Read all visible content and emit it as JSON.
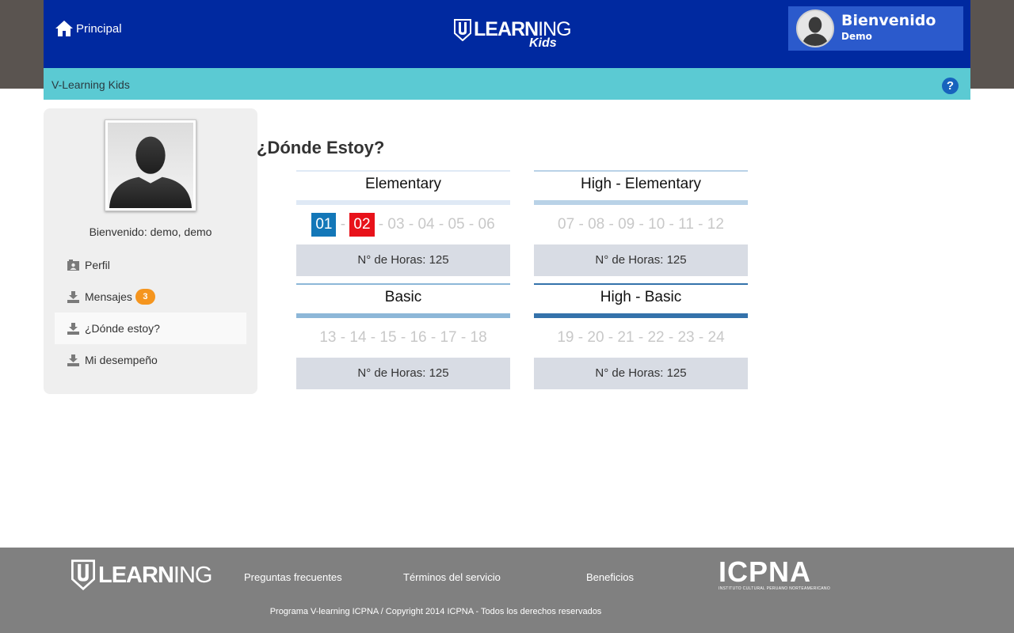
{
  "header": {
    "home_label": "Principal",
    "logo_word_bold": "LEARN",
    "logo_word_light": "ING",
    "logo_sub": "Kids",
    "user_greeting": "Bienvenido",
    "user_name": "Demo",
    "brand_color": "#0029a0"
  },
  "subbar": {
    "title": "V-Learning Kids",
    "help_glyph": "?"
  },
  "sidebar": {
    "welcome": "Bienvenido: demo, demo",
    "items": [
      {
        "label": "Perfil",
        "icon": "id-card-icon"
      },
      {
        "label": "Mensajes",
        "icon": "inbox-icon",
        "badge": "3"
      },
      {
        "label": "¿Dónde estoy?",
        "icon": "inbox-icon",
        "active": true
      },
      {
        "label": "Mi desempeño",
        "icon": "inbox-icon"
      }
    ]
  },
  "main": {
    "title": "¿Dónde Estoy?",
    "levels": [
      {
        "name": "Elementary",
        "units": [
          "01",
          "02",
          "03",
          "04",
          "05",
          "06"
        ],
        "done": [
          "01"
        ],
        "current": "02",
        "hours": "N° de Horas: 125",
        "accent": "#dfe9f5"
      },
      {
        "name": "High - Elementary",
        "units": [
          "07",
          "08",
          "09",
          "10",
          "11",
          "12"
        ],
        "done": [],
        "current": null,
        "hours": "N° de Horas: 125",
        "accent": "#b9d2e7"
      },
      {
        "name": "Basic",
        "units": [
          "13",
          "14",
          "15",
          "16",
          "17",
          "18"
        ],
        "done": [],
        "current": null,
        "hours": "N° de Horas: 125",
        "accent": "#8db7d8"
      },
      {
        "name": "High - Basic",
        "units": [
          "19",
          "20",
          "21",
          "22",
          "23",
          "24"
        ],
        "done": [],
        "current": null,
        "hours": "N° de Horas: 125",
        "accent": "#3472ab"
      }
    ]
  },
  "footer": {
    "logo_word_bold": "LEARN",
    "logo_word_light": "ING",
    "links": [
      "Preguntas frecuentes",
      "Términos del servicio",
      "Beneficios"
    ],
    "partner": "ICPNA",
    "partner_sub": "INSTITUTO CULTURAL PERUANO NORTEAMERICANO",
    "copyright": "Programa V-learning ICPNA / Copyright 2014 ICPNA - Todos los derechos reservados"
  }
}
